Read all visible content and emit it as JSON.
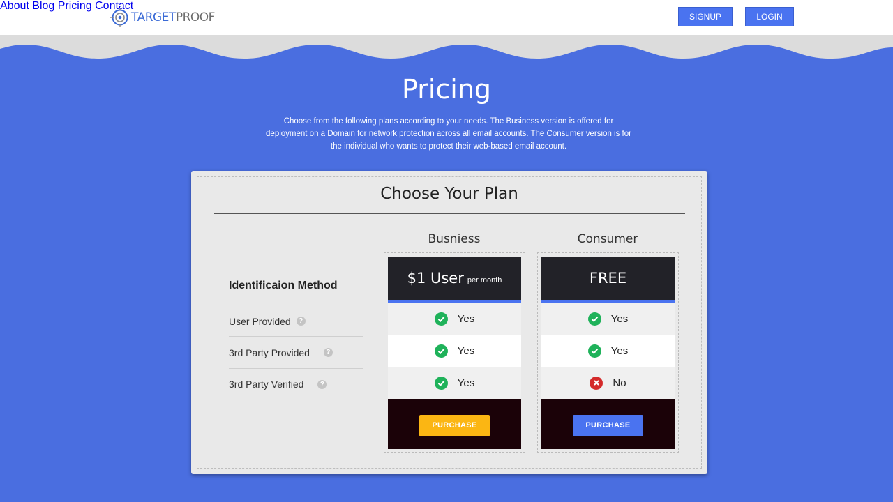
{
  "brand": {
    "part1": "TARGET",
    "part2": "PROOF",
    "icon": "target-logo-icon"
  },
  "nav": {
    "about": "About",
    "blog": "Blog",
    "pricing": "Pricing",
    "contact": "Contact",
    "signup": "SIGNUP",
    "login": "LOGIN"
  },
  "hero": {
    "title": "Pricing",
    "intro": "Choose from the following plans according to your needs. The Business version is offered for deployment on a Domain for network protection across all email accounts. The Consumer version is for the individual who wants to protect their web-based email account."
  },
  "plan_table": {
    "title": "Choose Your Plan",
    "feature_heading": "Identificaion Method",
    "features": [
      "User Provided",
      "3rd Party Provided",
      "3rd Party Verified"
    ],
    "help_glyph": "?",
    "plans": [
      {
        "name": "Busniess",
        "price_main": "$1 User",
        "price_sub": "per month",
        "values": [
          "Yes",
          "Yes",
          "Yes"
        ],
        "icons": [
          "check-icon",
          "check-icon",
          "check-icon"
        ],
        "button": "PURCHASE",
        "button_color": "#fbb613"
      },
      {
        "name": "Consumer",
        "price_main": "FREE",
        "price_sub": "",
        "values": [
          "Yes",
          "Yes",
          "No"
        ],
        "icons": [
          "check-icon",
          "check-icon",
          "cross-icon"
        ],
        "button": "PURCHASE",
        "button_color": "#4a73f0"
      }
    ]
  },
  "colors": {
    "background": "#4a6ee0",
    "accent": "#4a73f0",
    "success": "#1fb25a",
    "danger": "#d42a2a"
  }
}
